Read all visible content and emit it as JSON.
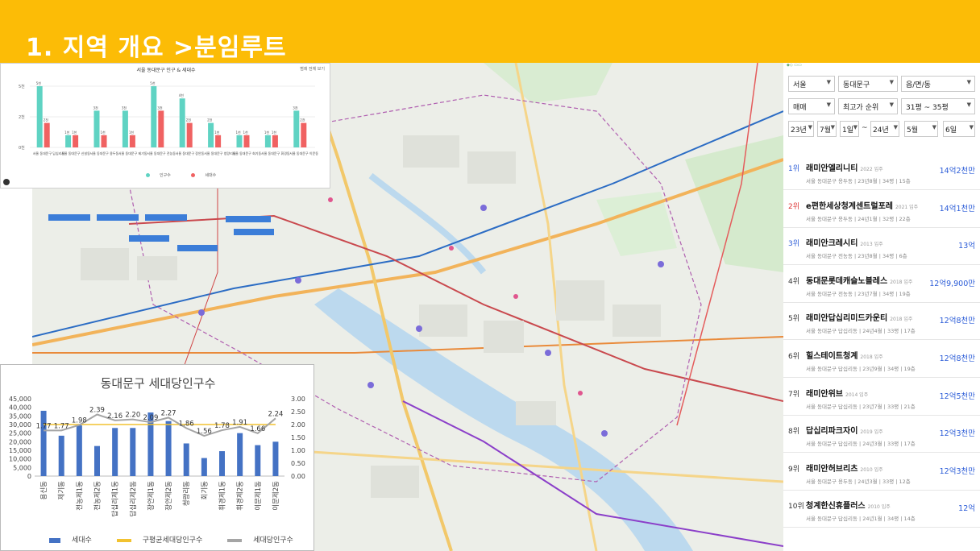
{
  "slide": {
    "title": "1. 지역 개요 >분임루트"
  },
  "pop_chart": {
    "title": "서울 동대문구 인구 & 세대수",
    "corner_label": "범례 전체 보기",
    "y_ticks": [
      "5천",
      "2천",
      "0천"
    ],
    "legend": [
      "인구수",
      "세대수"
    ],
    "colors": {
      "pop": "#5fd3c3",
      "hh": "#f06262"
    },
    "categories": [
      "서울 동대문구 답십리동",
      "서울 동대문구 신설동",
      "서울 동대문구 용두동",
      "서울 동대문구 제기동",
      "서울 동대문구 전농동",
      "서울 동대문구 장안동",
      "서울 동대문구 청량리동",
      "서울 동대문구 회기동",
      "서울 동대문구 휘경동",
      "서울 동대문구 이문동"
    ],
    "value_labels": [
      [
        "5천",
        "2천"
      ],
      [
        "1천",
        "1천"
      ],
      [
        "3천",
        "1천"
      ],
      [
        "3천",
        "1천"
      ],
      [
        "5천",
        "3천"
      ],
      [
        "4천",
        "2천"
      ],
      [
        "2천",
        "1천"
      ],
      [
        "1천",
        "1천"
      ],
      [
        "1천",
        "1천"
      ],
      [
        "3천",
        "2천"
      ]
    ]
  },
  "chart_data": {
    "type": "bar",
    "title": "동대문구 세대당인구수",
    "categories": [
      "용신동",
      "제기동",
      "전농제1동",
      "전농제2동",
      "답십리제1동",
      "답십리제2동",
      "장안제1동",
      "장안제2동",
      "청량리동",
      "회기동",
      "휘경제1동",
      "휘경제2동",
      "이문제1동",
      "이문제2동"
    ],
    "series": [
      {
        "name": "세대수",
        "axis": "left",
        "type": "bar",
        "color": "#4472c4",
        "values": [
          38000,
          23500,
          29500,
          17500,
          28000,
          28000,
          37000,
          32000,
          19000,
          10500,
          14500,
          25000,
          18000,
          20000
        ]
      },
      {
        "name": "구평균세대당인구수",
        "axis": "right",
        "type": "line",
        "color": "#f2c230",
        "values": [
          2.0,
          2.0,
          2.0,
          2.0,
          2.0,
          2.0,
          2.0,
          2.0,
          2.0,
          2.0,
          2.0,
          2.0,
          2.0,
          2.0
        ]
      },
      {
        "name": "세대당인구수",
        "axis": "right",
        "type": "line",
        "color": "#a5a5a5",
        "values": [
          1.77,
          1.77,
          1.98,
          2.39,
          2.16,
          2.2,
          2.09,
          2.27,
          1.86,
          1.56,
          1.78,
          1.91,
          1.66,
          2.24
        ]
      }
    ],
    "data_labels": [
      "1.77",
      "1.77",
      "1.98",
      "2.39",
      "2.16",
      "2.20",
      "2.09",
      "2.27",
      "1.86",
      "1.56",
      "1.78",
      "1.91",
      "1.66",
      "2.24"
    ],
    "y_left_ticks": [
      "45,000",
      "40,000",
      "35,000",
      "30,000",
      "25,000",
      "20,000",
      "15,000",
      "10,000",
      "5,000",
      "0"
    ],
    "y_right_ticks": [
      "3.00",
      "2.50",
      "2.00",
      "1.50",
      "1.00",
      "0.50",
      "0.00"
    ],
    "ylim_left": [
      0,
      45000
    ],
    "ylim_right": [
      0,
      3
    ],
    "legend_position": "bottom"
  },
  "ranking": {
    "filters": {
      "city": "서울",
      "district": "동대문구",
      "town": "읍/면/동",
      "deal": "매매",
      "sort": "최고가 순위",
      "size": "31평 ~ 35평",
      "from_year": "23년",
      "from_month": "7월",
      "from_day": "1일",
      "tilde": "~",
      "to_year": "24년",
      "to_month": "5월",
      "to_day": "6일"
    },
    "items": [
      {
        "rank": "1위",
        "name": "래미안엘리니티",
        "year": "2022 입주",
        "sub": "서울 동대문구 용두동 | 23년8월 | 34평 | 15층",
        "price": "14억2천만",
        "color": "blue"
      },
      {
        "rank": "2위",
        "name": "e편한세상청계센트럴포레",
        "year": "2021 입주",
        "sub": "서울 동대문구 용두동 | 24년1월 | 32평 | 22층",
        "price": "14억1천만",
        "color": "red"
      },
      {
        "rank": "3위",
        "name": "래미안크레시티",
        "year": "2013 입주",
        "sub": "서울 동대문구 전농동 | 23년8월 | 34평 | 6층",
        "price": "13억",
        "color": "blue"
      },
      {
        "rank": "4위",
        "name": "동대문롯데캐슬노블레스",
        "year": "2018 입주",
        "sub": "서울 동대문구 전농동 | 23년7월 | 34평 | 19층",
        "price": "12억9,900만",
        "color": "none"
      },
      {
        "rank": "5위",
        "name": "래미안답십리미드카운티",
        "year": "2018 입주",
        "sub": "서울 동대문구 답십리동 | 24년4월 | 33평 | 17층",
        "price": "12억8천만",
        "color": "none"
      },
      {
        "rank": "6위",
        "name": "힐스테이트청계",
        "year": "2018 입주",
        "sub": "서울 동대문구 답십리동 | 23년9월 | 34평 | 19층",
        "price": "12억8천만",
        "color": "none"
      },
      {
        "rank": "7위",
        "name": "래미안위브",
        "year": "2014 입주",
        "sub": "서울 동대문구 답십리동 | 23년7월 | 33평 | 21층",
        "price": "12억5천만",
        "color": "none"
      },
      {
        "rank": "8위",
        "name": "답십리파크자이",
        "year": "2019 입주",
        "sub": "서울 동대문구 답십리동 | 24년3월 | 33평 | 17층",
        "price": "12억3천만",
        "color": "none"
      },
      {
        "rank": "9위",
        "name": "래미안허브리츠",
        "year": "2010 입주",
        "sub": "서울 동대문구 용두동 | 24년3월 | 33평 | 12층",
        "price": "12억3천만",
        "color": "none"
      },
      {
        "rank": "10위",
        "name": "청계한신휴플러스",
        "year": "2010 입주",
        "sub": "서울 동대문구 답십리동 | 24년1월 | 34평 | 14층",
        "price": "12억",
        "color": "none"
      }
    ]
  }
}
